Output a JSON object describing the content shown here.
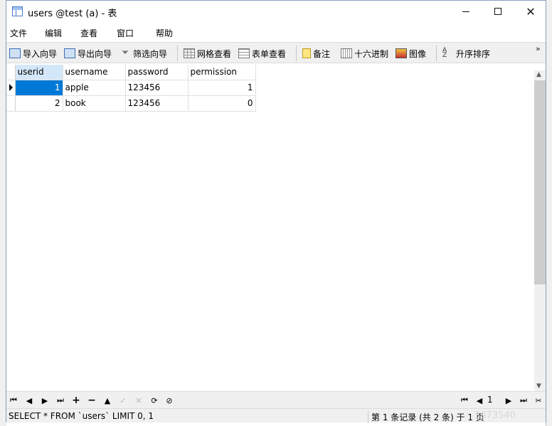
{
  "window": {
    "title": "users @test (a) - 表"
  },
  "menu": [
    "文件",
    "编辑",
    "查看",
    "窗口",
    "帮助"
  ],
  "toolbar": {
    "import_wizard": "导入向导",
    "export_wizard": "导出向导",
    "filter_wizard": "筛选向导",
    "grid_view": "网格查看",
    "form_view": "表单查看",
    "memo": "备注",
    "hex": "十六进制",
    "image": "图像",
    "sort_asc": "升序排序",
    "more": "»"
  },
  "table": {
    "columns": [
      "userid",
      "username",
      "password",
      "permission"
    ],
    "rows": [
      [
        "1",
        "apple",
        "123456",
        "1"
      ],
      [
        "2",
        "book",
        "123456",
        "0"
      ]
    ]
  },
  "navigation": {
    "page": "1"
  },
  "status": {
    "sql": "SELECT * FROM `users` LIMIT 0, 1",
    "record": "第 1 条记录 (共 2 条) 于 1 页",
    "watermark": "3673540"
  },
  "colors": {
    "selection": "#0078d7",
    "header_selected": "#d4e7f9",
    "toolbar_bg": "#f0f0f0"
  }
}
